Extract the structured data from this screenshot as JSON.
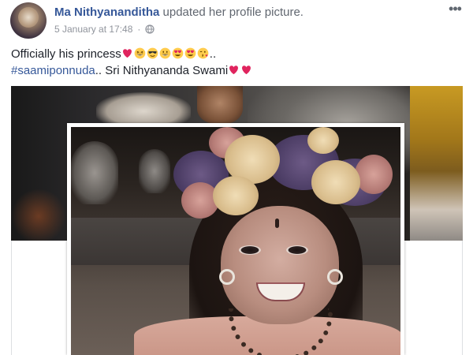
{
  "post": {
    "author": "Ma Nithyananditha",
    "action": "updated her profile picture.",
    "timestamp": "5 January at 17:48",
    "privacy_icon": "globe-icon",
    "options_icon": "more-options-icon",
    "caption": {
      "line1_text": "Officially his princess",
      "line1_emojis": [
        "red-heart-emoji",
        "grinning-squinting-face-emoji",
        "smiling-face-with-sunglasses-emoji",
        "grinning-face-emoji",
        "heart-eyes-emoji",
        "heart-eyes-emoji",
        "face-blowing-kiss-emoji"
      ],
      "line1_suffix": "..",
      "hashtag": "#saamiponnuda",
      "line2_text": ".. Sri Nithyananda Swami",
      "line2_emojis": [
        "red-heart-emoji",
        "red-heart-emoji"
      ]
    }
  },
  "colors": {
    "author_link": "#365899",
    "meta_text": "#90949c",
    "heart": "#e0245e",
    "emoji_face": "#ffcc4d"
  }
}
